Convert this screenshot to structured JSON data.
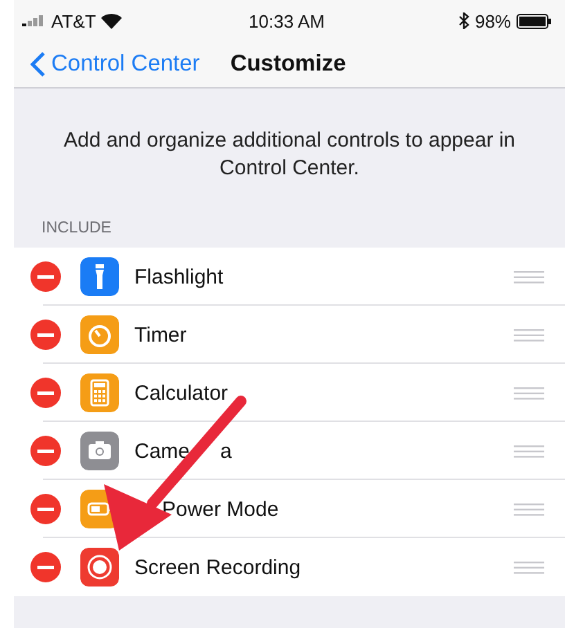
{
  "status_bar": {
    "carrier": "AT&T",
    "time": "10:33 AM",
    "battery": "98%"
  },
  "nav": {
    "back": "Control Center",
    "title": "Customize"
  },
  "description": "Add and organize additional controls to appear in Control Center.",
  "section": "INCLUDE",
  "controls": [
    {
      "label": "Flashlight",
      "kind": "flashlight",
      "color": "#1a7cf5"
    },
    {
      "label": "Timer",
      "kind": "timer",
      "color": "#f59d16"
    },
    {
      "label": "Calculator",
      "kind": "calculator",
      "color": "#f59d16"
    },
    {
      "label": "Came",
      "label_tail": "a",
      "kind": "camera",
      "color": "#8e8e93"
    },
    {
      "label": "Power Mode",
      "covered": true,
      "kind": "battery",
      "color": "#f59d16"
    },
    {
      "label": "Screen Recording",
      "kind": "record",
      "color": "#ee3b30"
    }
  ]
}
